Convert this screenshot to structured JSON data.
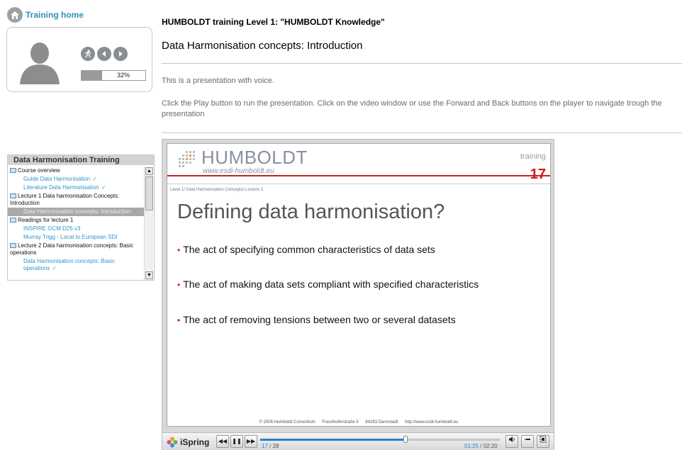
{
  "nav": {
    "home_label": "Training home"
  },
  "profile": {
    "progress_percent": 32,
    "progress_label": "32%",
    "buttons": [
      "runner-icon",
      "back-arrow-icon",
      "forward-arrow-icon"
    ]
  },
  "header": {
    "course_title": "HUMBOLDT training Level 1: \"HUMBOLDT Knowledge\"",
    "lesson_title": "Data Harmonisation concepts: Introduction"
  },
  "intro": {
    "line1": "This is a presentation with voice.",
    "line2": "Click the Play button to run the presentation. Click on the video window or use the Forward and Back buttons on the player to navigate trough the presentation"
  },
  "tree": {
    "title": "Data Harmonisation Training",
    "items": [
      {
        "label": "Course overview",
        "type": "lecture"
      },
      {
        "label": "Guide Data Harmonisation",
        "type": "child",
        "done": true
      },
      {
        "label": "Literature Data Harmonisation",
        "type": "child",
        "done": true
      },
      {
        "label": "Lecture 1 Data harmonisation Concepts: Introduction",
        "type": "lecture"
      },
      {
        "label": "Data Harmonisation concepts: Introduction",
        "type": "child",
        "done": true,
        "selected": true
      },
      {
        "label": "Readings for lecture 1",
        "type": "lecture"
      },
      {
        "label": "INSPIRE GCM D25 v3",
        "type": "child"
      },
      {
        "label": "Murray Trigg - Local to European SDI",
        "type": "child"
      },
      {
        "label": "Lecture 2 Data harmonisation concepts: Basic operations",
        "type": "lecture"
      },
      {
        "label": "Data Harmonisation concepts: Basic operations",
        "type": "child",
        "done": true
      }
    ]
  },
  "slide": {
    "logo_text": "HUMBOLDT",
    "logo_url": "www.esdi-humboldt.eu",
    "training_label": "training",
    "number": "17",
    "breadcrumb": "Level 1/ Data Harmonisation Concepts/ Lecture 1",
    "heading": "Defining data harmonisation?",
    "bullets": [
      "The act of specifying common characteristics of data sets",
      "The act of making data sets compliant with specified characteristics",
      "The act of removing tensions between two or several datasets"
    ],
    "footer": [
      "© 2006 Humboldt Consortium",
      "Fraunhoferstraße 5",
      "64283 Darmstadt",
      "http://www.esdi-humboldt.eu"
    ]
  },
  "player": {
    "brand": "iSpring",
    "current_slide": "17",
    "total_slides": "/ 28",
    "elapsed": "01:25",
    "duration": "/ 02:20",
    "seek_fraction": 0.607
  },
  "colors": {
    "accent_blue": "#2f8fc0",
    "brand_red": "#c81d1d",
    "check_green": "#4fb94f"
  }
}
